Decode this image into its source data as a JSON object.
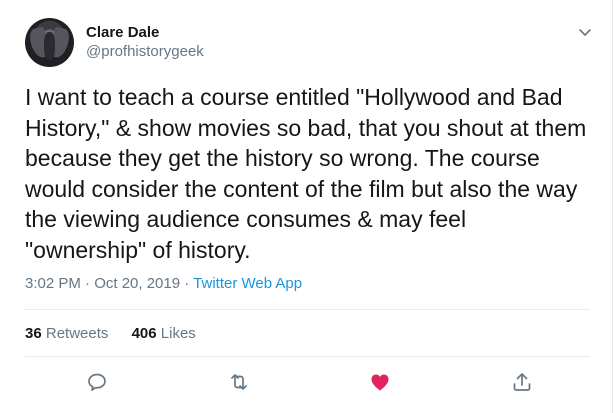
{
  "author": {
    "name": "Clare Dale",
    "handle": "@profhistorygeek"
  },
  "tweet": {
    "text": "I want to teach a course entitled \"Hollywood and Bad\nHistory,\" & show movies so bad, that you shout at them\nbecause they get the history so wrong. The course\nwould consider the content of the film but also the way\nthe viewing audience consumes & may feel\n\"ownership\" of  history.",
    "time": "3:02 PM · Oct 20, 2019",
    "separator": " · ",
    "source": "Twitter Web App"
  },
  "stats": {
    "retweets_count": "36",
    "retweets_label": "Retweets",
    "likes_count": "406",
    "likes_label": "Likes"
  },
  "actions": {
    "reply_icon": "speech-bubble",
    "retweet_icon": "retweet-arrows",
    "like_icon": "heart-filled",
    "share_icon": "upload-arrow",
    "like_color": "#e0245e",
    "icon_color": "#657786"
  },
  "colors": {
    "text": "#14171a",
    "secondary": "#657786",
    "link": "#1b95e0",
    "border": "#e6ecf0"
  }
}
